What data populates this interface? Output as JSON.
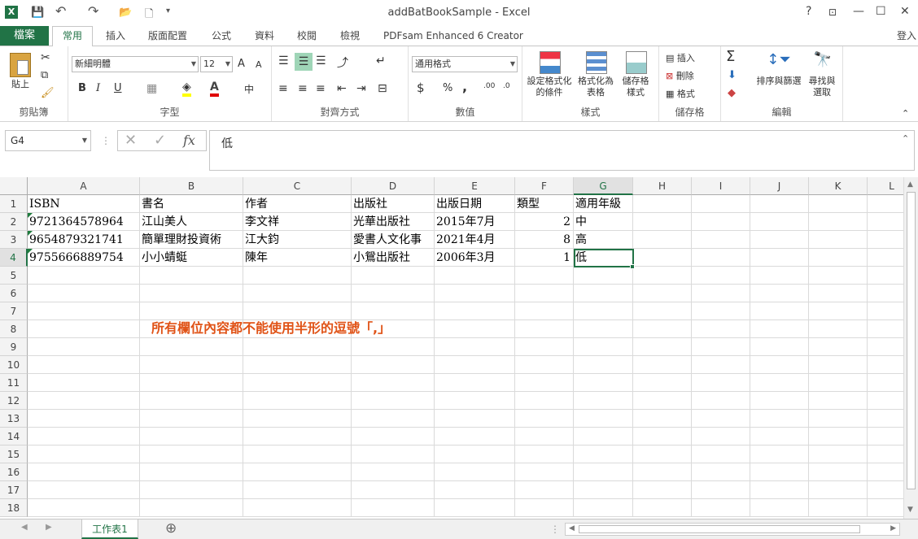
{
  "window": {
    "title": "addBatBookSample - Excel",
    "help": "?",
    "signin": "登入"
  },
  "qat": {
    "excel": "X",
    "save": "💾",
    "undo": "↶",
    "redo": "↷",
    "open": "📂",
    "new": "🗋",
    "more": "▾"
  },
  "tabs": {
    "file": "檔案",
    "items": [
      "常用",
      "插入",
      "版面配置",
      "公式",
      "資料",
      "校閱",
      "檢視",
      "PDFsam Enhanced 6 Creator"
    ],
    "active": "常用"
  },
  "ribbon": {
    "clipboard": {
      "paste": "貼上",
      "label": "剪貼簿"
    },
    "font": {
      "name": "新細明體",
      "size": "12",
      "bold": "B",
      "italic": "I",
      "underline": "U",
      "grow": "A",
      "shrink": "A",
      "label": "字型",
      "phonetic": "中"
    },
    "alignment": {
      "label": "對齊方式"
    },
    "number": {
      "format": "通用格式",
      "currency": "$",
      "percent": "%",
      "comma": ",",
      "label": "數值"
    },
    "styles": {
      "conditional": "設定格式化的條件",
      "table": "格式化為表格",
      "cell": "儲存格樣式",
      "label": "樣式"
    },
    "cells": {
      "insert": "插入",
      "delete": "刪除",
      "format": "格式",
      "label": "儲存格"
    },
    "editing": {
      "sort": "排序與篩選",
      "find": "尋找與選取",
      "label": "編輯"
    }
  },
  "formula_bar": {
    "name_box": "G4",
    "value": "低",
    "fx": "fx"
  },
  "columns": [
    "A",
    "B",
    "C",
    "D",
    "E",
    "F",
    "G",
    "H",
    "I",
    "J",
    "K",
    "L"
  ],
  "rows": [
    "1",
    "2",
    "3",
    "4",
    "5",
    "6",
    "7",
    "8",
    "9",
    "10",
    "11",
    "12",
    "13",
    "14",
    "15",
    "16",
    "17",
    "18"
  ],
  "table": {
    "header": [
      "ISBN",
      "書名",
      "作者",
      "出版社",
      "出版日期",
      "類型",
      "適用年級"
    ],
    "rows": [
      [
        "9721364578964",
        "江山美人",
        "李文祥",
        "光華出版社",
        "2015年7月",
        "2",
        "中"
      ],
      [
        "9654879321741",
        "簡單理財投資術",
        "江大鈞",
        "愛書人文化事",
        "2021年4月",
        "8",
        "高"
      ],
      [
        "9755666889754",
        "小小蜻蜓",
        "陳年",
        "小鴛出版社",
        "2006年3月",
        "1",
        "低"
      ]
    ]
  },
  "note": "所有欄位內容都不能使用半形的逗號「,」",
  "sheet": {
    "tab": "工作表1",
    "add": "⊕"
  },
  "accent": "#217346",
  "note_color": "#e05317"
}
